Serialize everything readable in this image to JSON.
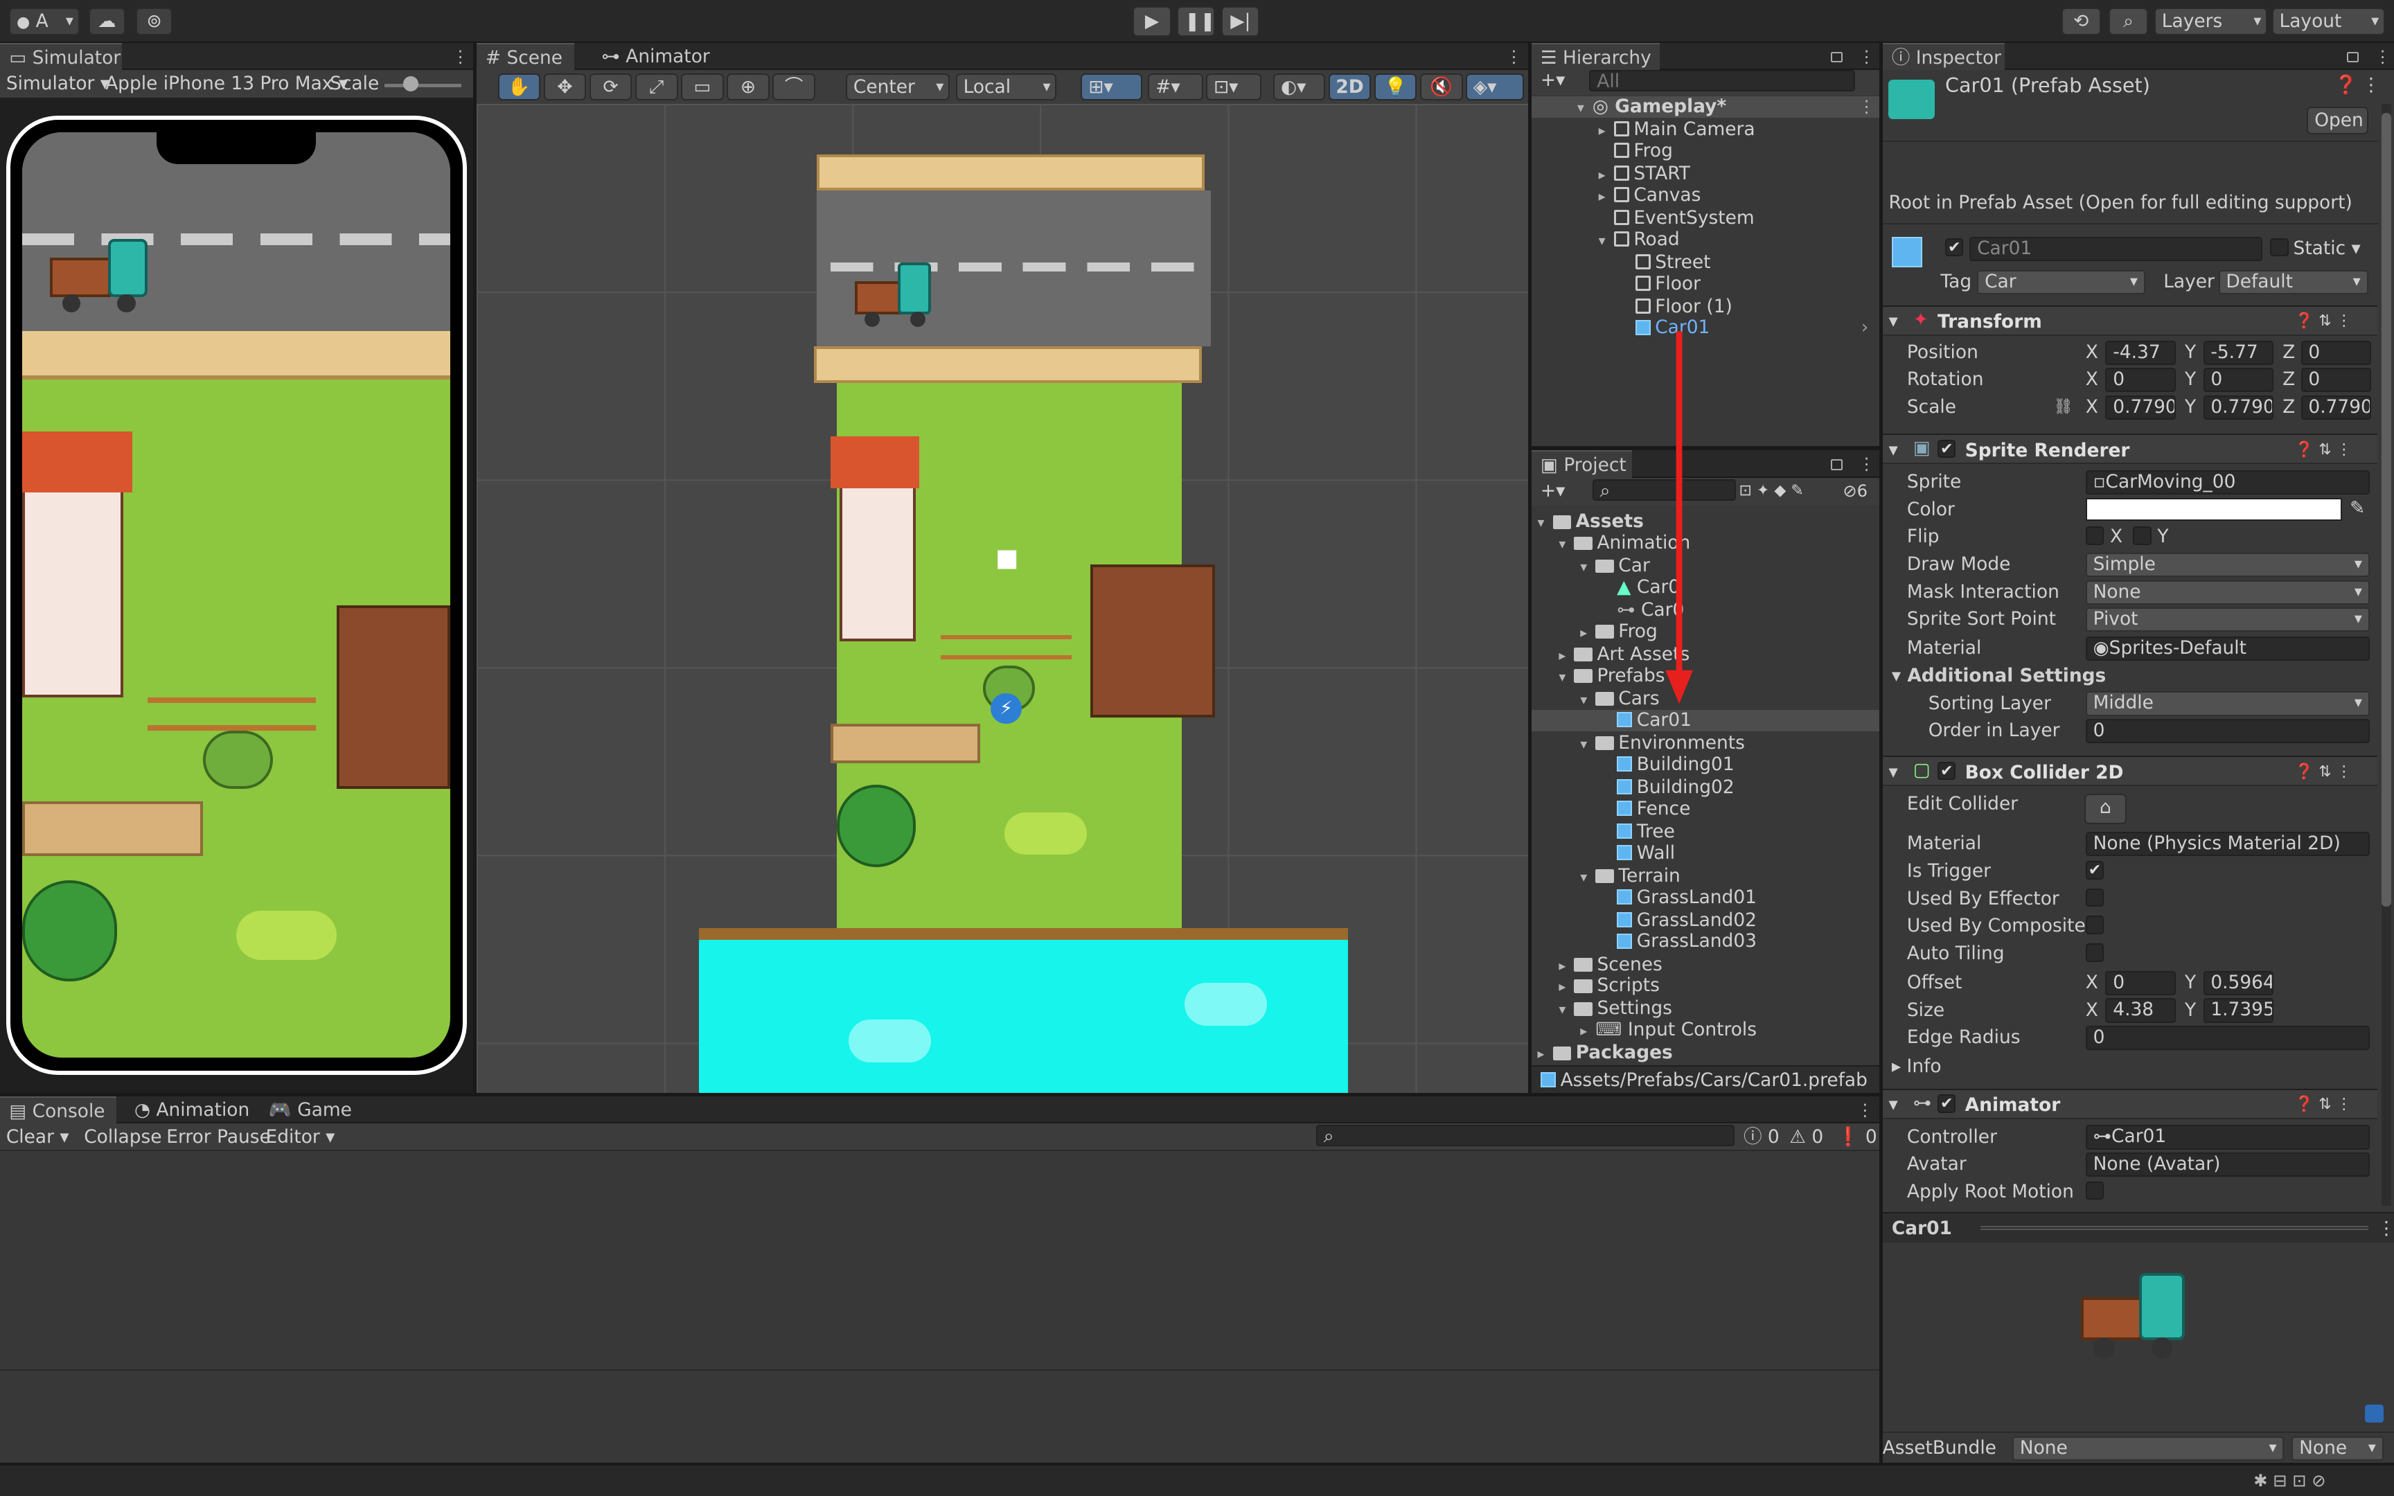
{
  "toolbar": {
    "account": "A",
    "layers": "Layers",
    "layout": "Layout"
  },
  "simulator": {
    "tab": "Simulator",
    "mode": "Simulator",
    "device": "Apple iPhone 13 Pro Max",
    "scale": "Scale"
  },
  "scene": {
    "tab_scene": "Scene",
    "tab_animator": "Animator",
    "pivot": "Center",
    "space": "Local",
    "mode_2d": "2D"
  },
  "hierarchy": {
    "tab": "Hierarchy",
    "search_placeholder": "All",
    "scene_name": "Gameplay*",
    "items": [
      "Main Camera",
      "Frog",
      "START",
      "Canvas",
      "EventSystem",
      "Road",
      "Street",
      "Floor",
      "Floor (1)",
      "Car01"
    ]
  },
  "project": {
    "tab": "Project",
    "badge": "6",
    "path": "Assets/Prefabs/Cars/Car01.prefab",
    "items": [
      "Assets",
      "Animation",
      "Car",
      "Car0",
      "Car0",
      "Frog",
      "Art Assets",
      "Prefabs",
      "Cars",
      "Car01",
      "Environments",
      "Building01",
      "Building02",
      "Fence",
      "Tree",
      "Wall",
      "Terrain",
      "GrassLand01",
      "GrassLand02",
      "GrassLand03",
      "Scenes",
      "Scripts",
      "Settings",
      "Input Controls",
      "Packages"
    ]
  },
  "inspector": {
    "tab": "Inspector",
    "title": "Car01 (Prefab Asset)",
    "open": "Open",
    "root_note": "Root in Prefab Asset (Open for full editing support)",
    "name": "Car01",
    "static": "Static",
    "tag_label": "Tag",
    "tag": "Car",
    "layer_label": "Layer",
    "layer": "Default",
    "transform": {
      "title": "Transform",
      "position": "Position",
      "rotation": "Rotation",
      "scale": "Scale",
      "px": "-4.37",
      "py": "-5.77",
      "pz": "0",
      "rx": "0",
      "ry": "0",
      "rz": "0",
      "sx": "0.77903",
      "sy": "0.77903",
      "sz": "0.77903"
    },
    "sprite": {
      "title": "Sprite Renderer",
      "sprite_label": "Sprite",
      "sprite": "CarMoving_00",
      "color": "Color",
      "flip": "Flip",
      "x": "X",
      "y": "Y",
      "draw_mode_label": "Draw Mode",
      "draw_mode": "Simple",
      "mask_label": "Mask Interaction",
      "mask": "None",
      "sort_point_label": "Sprite Sort Point",
      "sort_point": "Pivot",
      "material_label": "Material",
      "material": "Sprites-Default",
      "additional": "Additional Settings",
      "sorting_layer_label": "Sorting Layer",
      "sorting_layer": "Middle",
      "order_label": "Order in Layer",
      "order": "0"
    },
    "collider": {
      "title": "Box Collider 2D",
      "edit": "Edit Collider",
      "material_label": "Material",
      "material": "None (Physics Material 2D)",
      "trigger": "Is Trigger",
      "effector": "Used By Effector",
      "composite": "Used By Composite",
      "tiling": "Auto Tiling",
      "offset": "Offset",
      "ox": "0",
      "oy": "0.59649",
      "size": "Size",
      "sx": "4.38",
      "sy": "1.73952",
      "edge": "Edge Radius",
      "edge_val": "0",
      "info": "Info"
    },
    "animator": {
      "title": "Animator",
      "controller_label": "Controller",
      "controller": "Car01",
      "avatar_label": "Avatar",
      "avatar": "None (Avatar)",
      "root_motion": "Apply Root Motion"
    },
    "preview": "Car01",
    "assetbundle": "AssetBundle",
    "ab1": "None",
    "ab2": "None"
  },
  "console": {
    "tab_console": "Console",
    "tab_animation": "Animation",
    "tab_game": "Game",
    "clear": "Clear",
    "collapse": "Collapse",
    "error_pause": "Error Pause",
    "editor": "Editor",
    "c1": "0",
    "c2": "0",
    "c3": "0"
  }
}
